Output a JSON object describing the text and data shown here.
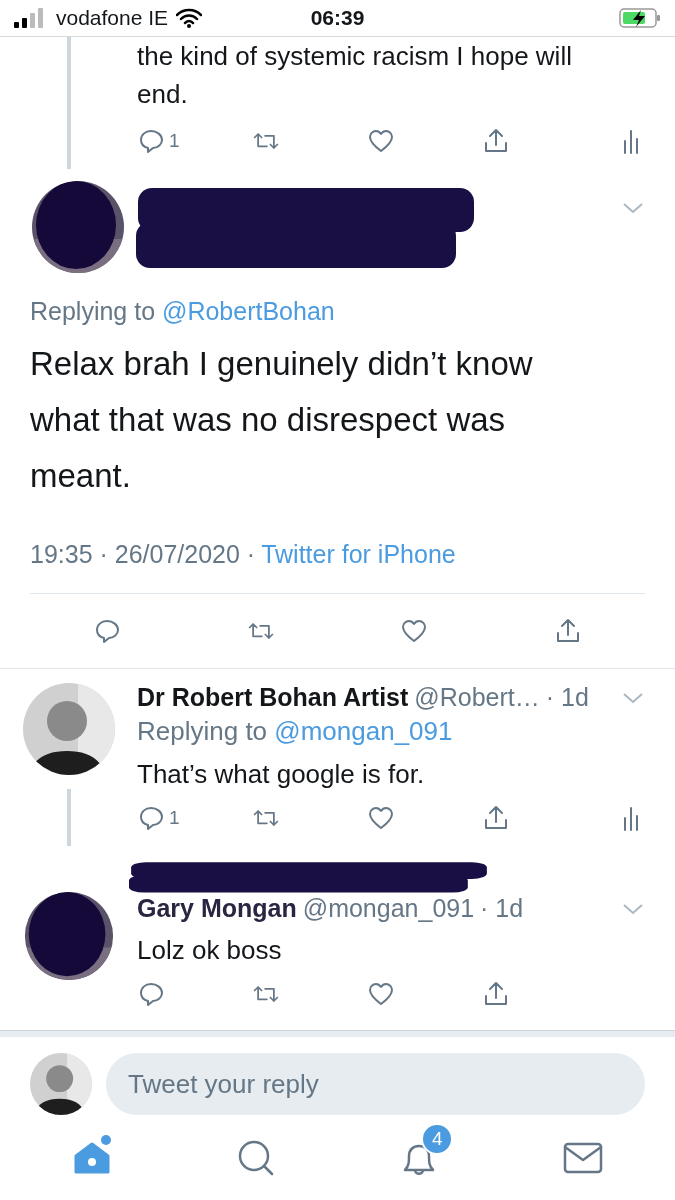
{
  "status_bar": {
    "carrier": "vodafone IE",
    "time": "06:39",
    "charging": true
  },
  "previous_tweet": {
    "text": "the kind of systemic racism I hope will end.",
    "reply_count": "1",
    "analytics": true
  },
  "main_tweet": {
    "redacted": true,
    "replying_label": "Replying to",
    "replying_handle": "@RobertBohan",
    "text": "Relax brah I genuinely didn’t know what that was no disrespect was meant.",
    "meta": "19:35 · 26/07/2020 ·",
    "source": "Twitter for iPhone"
  },
  "replies": [
    {
      "redacted": false,
      "name": "Dr Robert Bohan Artist",
      "handle": "@Robert…",
      "age": "· 1d",
      "replying_label": "Replying to",
      "replying_handle": "@mongan_091",
      "text": "That’s what google is for.",
      "reply_count": "1",
      "analytics": true,
      "thread_below": true
    },
    {
      "redacted": true,
      "name": "Gary Mongan",
      "handle": "@mongan_091",
      "age": "· 1d",
      "text": "Lolz ok boss",
      "analytics": false,
      "thread_below": false
    }
  ],
  "composer": {
    "placeholder": "Tweet your reply"
  },
  "tabs": [
    {
      "kind": "home",
      "selected": true,
      "has_new": true
    },
    {
      "kind": "search",
      "selected": false
    },
    {
      "kind": "notifications",
      "selected": false,
      "badge": "4"
    },
    {
      "kind": "messages",
      "selected": false
    }
  ]
}
